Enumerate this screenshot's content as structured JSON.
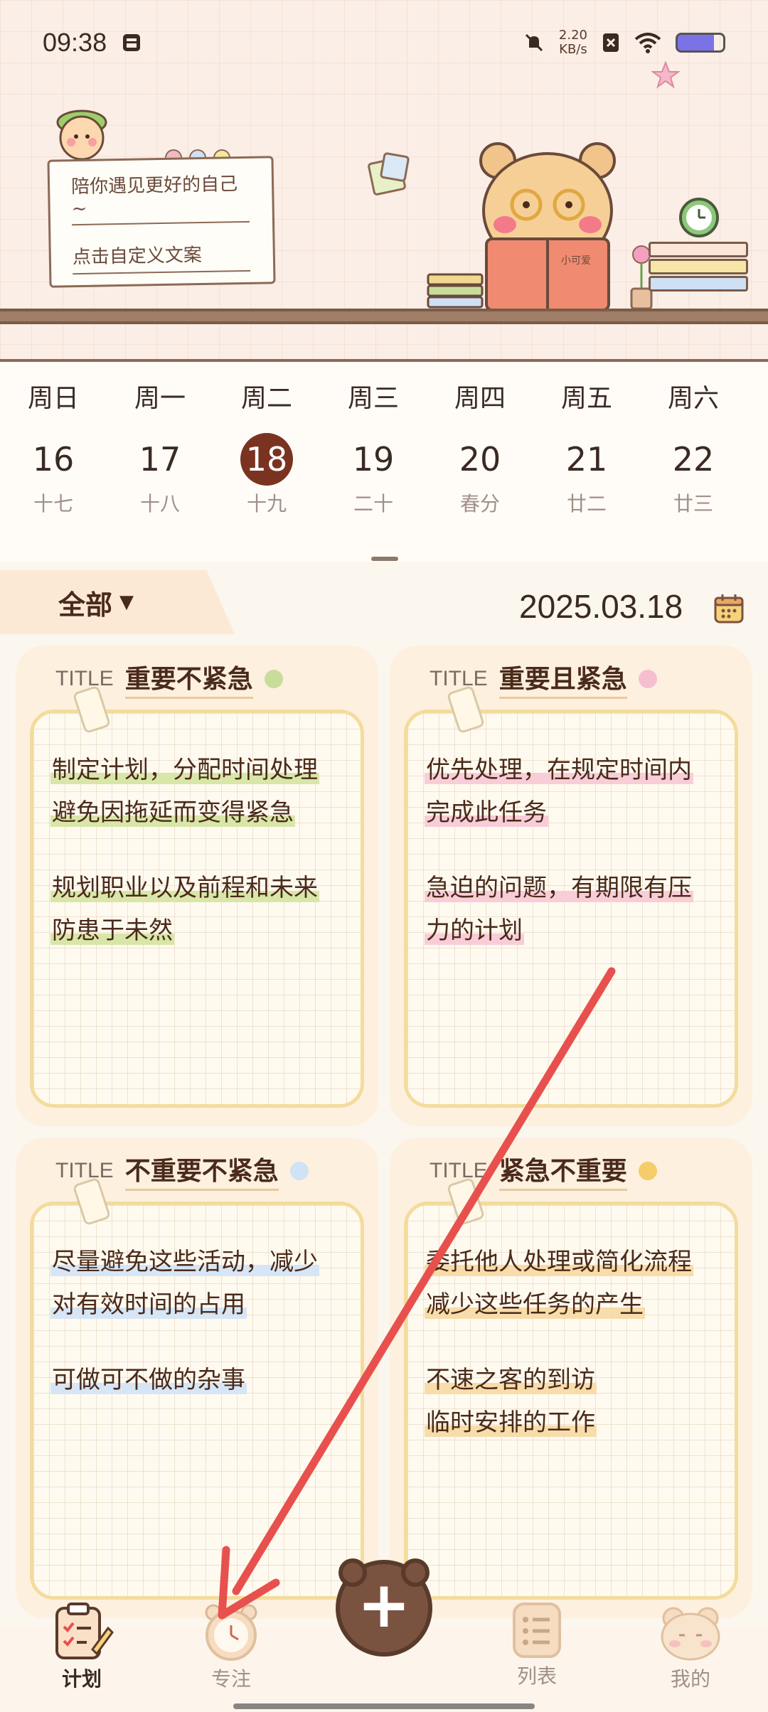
{
  "status": {
    "time": "09:38",
    "netspeed_value": "2.20",
    "netspeed_unit": "KB/s"
  },
  "banner": {
    "line1": "陪你遇见更好的自己~",
    "line2": "点击自定义文案",
    "book_label": "小可爱"
  },
  "calendar": {
    "weekdays": [
      "周日",
      "周一",
      "周二",
      "周三",
      "周四",
      "周五",
      "周六"
    ],
    "dates": [
      "16",
      "17",
      "18",
      "19",
      "20",
      "21",
      "22"
    ],
    "lunar": [
      "十七",
      "十八",
      "十九",
      "二十",
      "春分",
      "廿二",
      "廿三"
    ],
    "selected_index": 2
  },
  "filter": {
    "label": "全部",
    "date": "2025.03.18"
  },
  "quadrants": {
    "q1": {
      "title_label": "TITLE",
      "title": "重要不紧急",
      "dot_color": "#c9dc9c",
      "highlight": "#d8e6a8",
      "lines": [
        "制定计划，分配时间处理",
        "避免因拖延而变得紧急",
        "规划职业以及前程和未来",
        "防患于未然"
      ]
    },
    "q2": {
      "title_label": "TITLE",
      "title": "重要且紧急",
      "dot_color": "#f6bfd0",
      "highlight": "#f8cdd8",
      "lines": [
        "优先处理，在规定时间内",
        "完成此任务",
        "急迫的问题，有期限有压",
        "力的计划"
      ]
    },
    "q3": {
      "title_label": "TITLE",
      "title": "不重要不紧急",
      "dot_color": "#cfe2f6",
      "highlight": "#d6e6f6",
      "lines": [
        "尽量避免这些活动，减少",
        "对有效时间的占用",
        "可做可不做的杂事"
      ]
    },
    "q4": {
      "title_label": "TITLE",
      "title": "紧急不重要",
      "dot_color": "#f4cc6a",
      "highlight": "#f8dcaa",
      "lines": [
        "委托他人处理或简化流程",
        "减少这些任务的产生",
        "不速之客的到访",
        "临时安排的工作"
      ]
    }
  },
  "nav": {
    "plan": "计划",
    "focus": "专注",
    "list": "列表",
    "me": "我的"
  },
  "colors": {
    "accent_brown": "#7a3320",
    "annotation_arrow": "#e8504e"
  }
}
